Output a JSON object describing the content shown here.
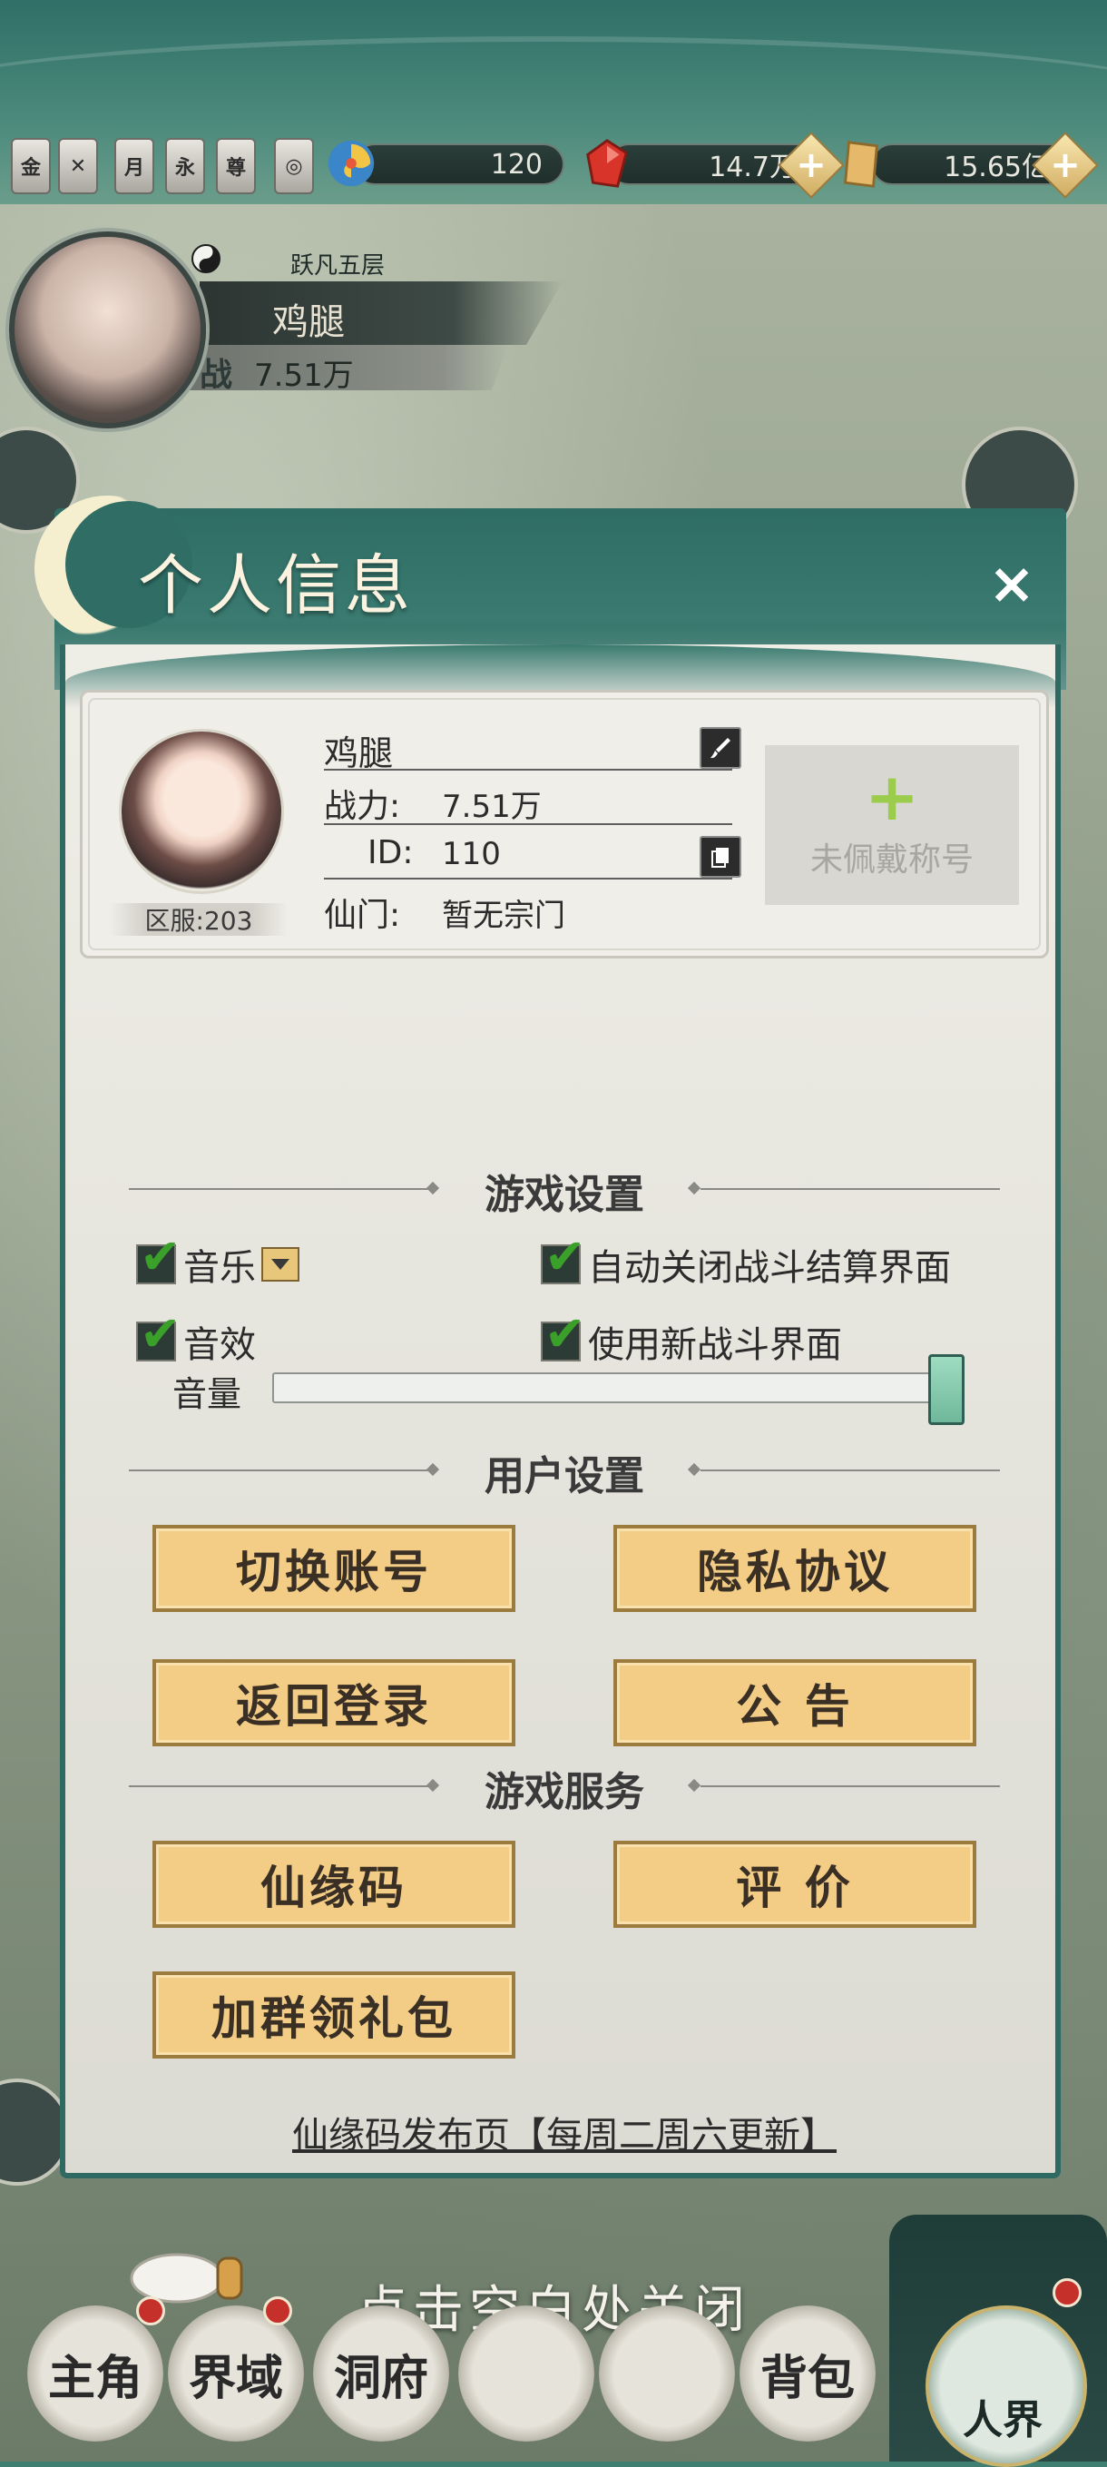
{
  "topbar": {
    "badges": [
      "金",
      "✕",
      "月",
      "永",
      "尊",
      "◎"
    ],
    "res1": "120",
    "res2": "14.7万",
    "res3": "15.65亿"
  },
  "player": {
    "realm": "跃凡五层",
    "name": "鸡腿",
    "power_icon": "战",
    "power": "7.51万"
  },
  "dialog": {
    "title": "个人信息",
    "close": "×",
    "profile": {
      "name": "鸡腿",
      "power_label": "战力:",
      "power_value": "7.51万",
      "id_label": "ID:",
      "id_value": "110",
      "sect_label": "仙门:",
      "sect_value": "暂无宗门",
      "server": "区服:203",
      "title_slot_plus": "+",
      "title_slot_text": "未佩戴称号"
    },
    "game_settings": {
      "title": "游戏设置",
      "music": "音乐",
      "auto_close": "自动关闭战斗结算界面",
      "sound": "音效",
      "new_battle_ui": "使用新战斗界面",
      "volume_label": "音量",
      "volume_level": 1.0
    },
    "user_settings": {
      "title": "用户设置",
      "switch_account": "切换账号",
      "privacy": "隐私协议",
      "back_login": "返回登录",
      "notice": "公 告"
    },
    "game_services": {
      "title": "游戏服务",
      "xianyuan_code": "仙缘码",
      "rate": "评 价",
      "join_group": "加群领礼包"
    },
    "link": "仙缘码发布页【每周二周六更新】"
  },
  "close_hint": "点击空白处关闭",
  "nav": {
    "items": [
      "主角",
      "界域",
      "洞府",
      "",
      "",
      "背包"
    ],
    "world": "人界"
  },
  "colors": {
    "accent_green": "#3aa02a",
    "button_gold": "#f3cd86",
    "dialog_teal": "#2f6d65"
  }
}
